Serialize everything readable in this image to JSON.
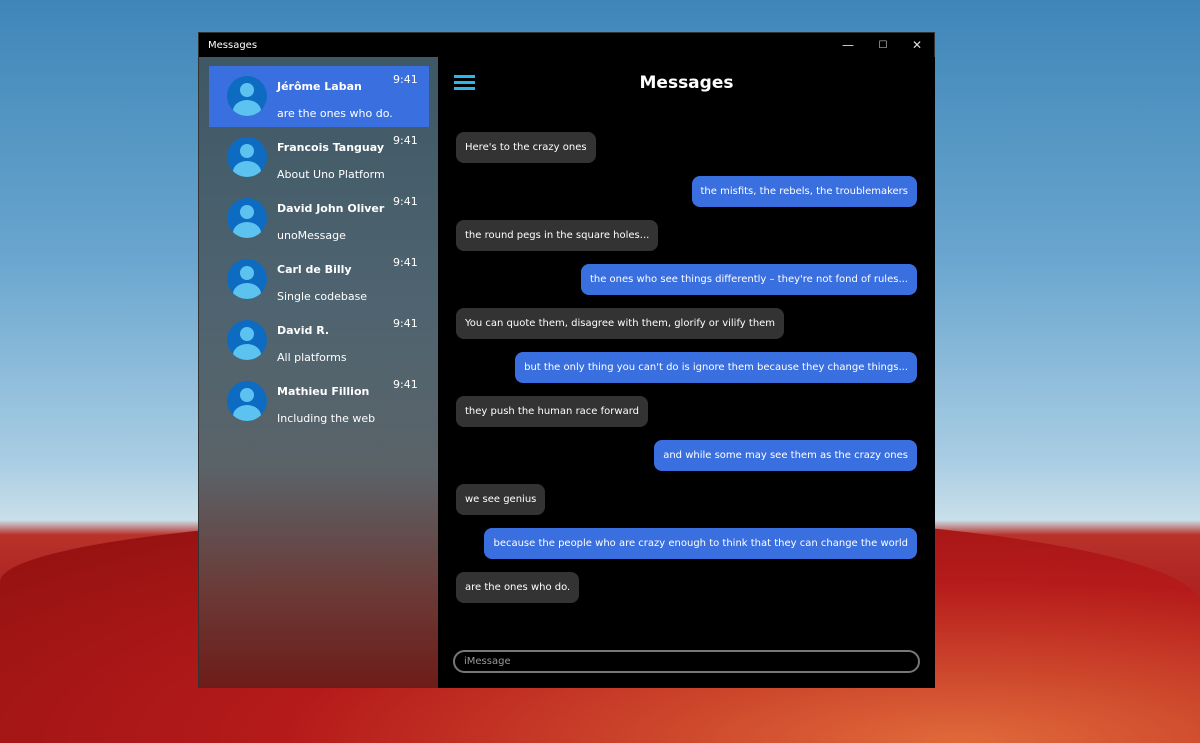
{
  "window": {
    "title": "Messages",
    "minimize": "—",
    "maximize": "☐",
    "close": "✕"
  },
  "header": {
    "title": "Messages",
    "menu_icon": "hamburger-icon"
  },
  "contacts": [
    {
      "name": "Jérôme Laban",
      "preview": "are the ones who do.",
      "time": "9:41",
      "selected": true
    },
    {
      "name": "Francois Tanguay",
      "preview": "About Uno Platform",
      "time": "9:41"
    },
    {
      "name": "David John Oliver",
      "preview": "unoMessage",
      "time": "9:41"
    },
    {
      "name": "Carl de Billy",
      "preview": "Single codebase",
      "time": "9:41"
    },
    {
      "name": "David R.",
      "preview": "All platforms",
      "time": "9:41"
    },
    {
      "name": "Mathieu Fillion",
      "preview": "Including the web",
      "time": "9:41"
    }
  ],
  "messages": [
    {
      "text": "Here's to the crazy ones",
      "dir": "in"
    },
    {
      "text": "the misfits, the rebels, the troublemakers",
      "dir": "out"
    },
    {
      "text": "the round pegs in the square holes...",
      "dir": "in"
    },
    {
      "text": "the ones who see things differently – they're not fond of rules...",
      "dir": "out"
    },
    {
      "text": "You can quote them, disagree with them, glorify or vilify them",
      "dir": "in"
    },
    {
      "text": "but the only thing you can't do is ignore them because they change things...",
      "dir": "out"
    },
    {
      "text": "they push the human race forward",
      "dir": "in"
    },
    {
      "text": "and while some may see them as the crazy ones",
      "dir": "out"
    },
    {
      "text": "we see genius",
      "dir": "in"
    },
    {
      "text": "because the people who are crazy enough to think that they can change the world",
      "dir": "out"
    },
    {
      "text": "are the ones who do.",
      "dir": "in"
    }
  ],
  "composer": {
    "placeholder": "iMessage"
  },
  "colors": {
    "accent": "#3a6fe0",
    "incoming": "#333333",
    "menu": "#2cb5ee"
  }
}
